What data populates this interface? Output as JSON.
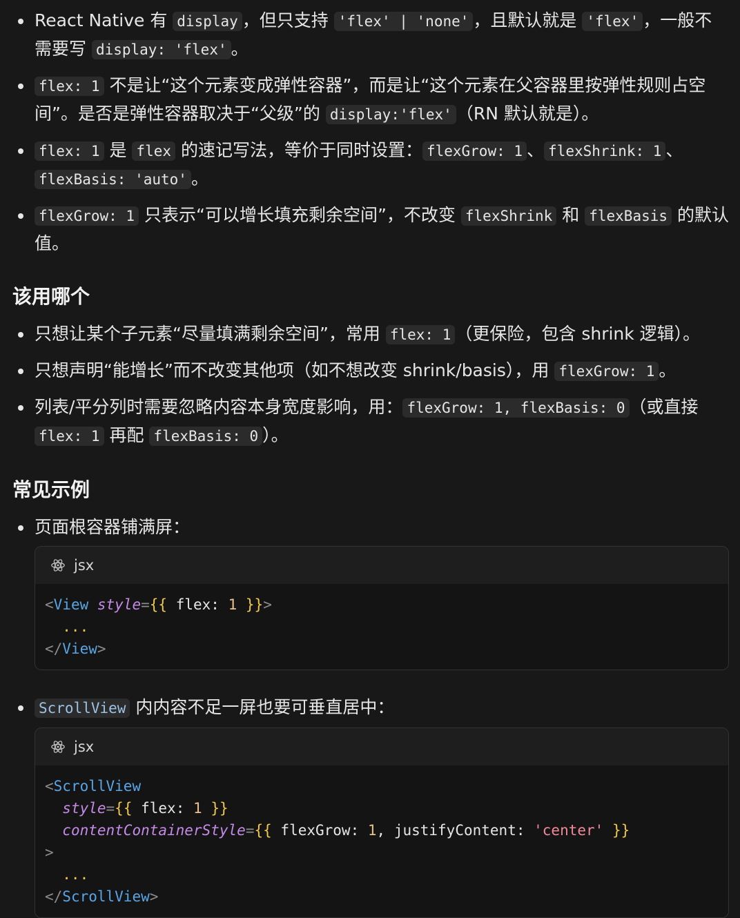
{
  "s1": {
    "b1": {
      "t1": "React Native 有 ",
      "c1": "display",
      "t2": "，但只支持 ",
      "c2": "'flex' | 'none'",
      "t3": "，且默认就是 ",
      "c3": "'flex'",
      "t4": "，一般不需要写 ",
      "c4": "display: 'flex'",
      "t5": "。"
    },
    "b2": {
      "c1": "flex: 1",
      "t1": " 不是让“这个元素变成弹性容器”，而是让“这个元素在父容器里按弹性规则占空间”。是否是弹性容器取决于“父级”的 ",
      "c2": "display:'flex'",
      "t2": "（RN 默认就是）。"
    },
    "b3": {
      "c1": "flex: 1",
      "t1": " 是 ",
      "c2": "flex",
      "t2": " 的速记写法，等价于同时设置：",
      "c3": "flexGrow: 1",
      "t3": "、",
      "c4": "flexShrink: 1",
      "t4": "、",
      "c5": "flexBasis: 'auto'",
      "t5": "。"
    },
    "b4": {
      "c1": "flexGrow: 1",
      "t1": " 只表示“可以增长填充剩余空间”，不改变 ",
      "c2": "flexShrink",
      "t2": " 和 ",
      "c3": "flexBasis",
      "t3": " 的默认值。"
    }
  },
  "s2": {
    "heading": "该用哪个",
    "b1": {
      "t1": "只想让某个子元素“尽量填满剩余空间”，常用 ",
      "c1": "flex: 1",
      "t2": "（更保险，包含 shrink 逻辑）。"
    },
    "b2": {
      "t1": "只想声明“能增长”而不改变其他项（如不想改变 shrink/basis），用 ",
      "c1": "flexGrow: 1",
      "t2": "。"
    },
    "b3": {
      "t1": "列表/平分列时需要忽略内容本身宽度影响，用：",
      "c1": "flexGrow: 1, flexBasis: 0",
      "t2": "（或直接 ",
      "c2": "flex: 1",
      "t3": " 再配 ",
      "c3": "flexBasis: 0",
      "t4": "）。"
    }
  },
  "s3": {
    "heading": "常见示例",
    "b1": {
      "t1": "页面根容器铺满屏：",
      "lang": "jsx",
      "code": {
        "l1": {
          "tag": "View",
          "attr": "style",
          "key": "flex",
          "val": "1"
        },
        "l2": "  ...",
        "l3": {
          "tag": "View"
        }
      }
    },
    "b2": {
      "c1": "ScrollView",
      "t1": " 内内容不足一屏也要可垂直居中：",
      "lang": "jsx",
      "code": {
        "tag": "ScrollView",
        "a1": {
          "attr": "style",
          "key": "flex",
          "val": "1"
        },
        "a2": {
          "attr": "contentContainerStyle",
          "k1": "flexGrow",
          "v1": "1",
          "k2": "justifyContent",
          "v2": "'center'"
        },
        "dots": "  ..."
      }
    }
  },
  "colors": {
    "bg": "#181818",
    "code_bg": "#141414",
    "tag": "#58a6e6",
    "attr": "#c58ae8",
    "brace": "#f2c94c",
    "number": "#e8c28a",
    "string": "#f08a9a"
  },
  "icons": {
    "code_lang": "react-atom-icon"
  }
}
